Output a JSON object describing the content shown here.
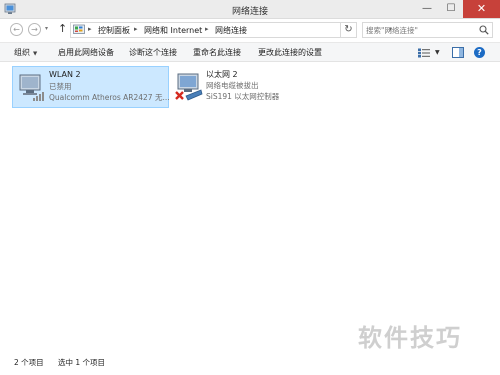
{
  "window": {
    "title": "网络连接",
    "minimize_glyph": "—",
    "maximize_glyph": "☐",
    "close_glyph": "✕"
  },
  "nav": {
    "back_glyph": "←",
    "forward_glyph": "→",
    "history_glyph": "▾",
    "up_glyph": "↑",
    "breadcrumb": [
      "控制面板",
      "网络和 Internet",
      "网络连接"
    ],
    "separator_glyph": "▸",
    "address_dropdown_glyph": "▾",
    "refresh_glyph": "↻",
    "search_placeholder": "搜索\"网络连接\"",
    "search_icon": "search-icon"
  },
  "toolbar": {
    "items": [
      "组织",
      "启用此网络设备",
      "诊断这个连接",
      "重命名此连接",
      "更改此连接的设置"
    ],
    "organize_caret": "▼",
    "view_caret": "▼",
    "help_glyph": "?"
  },
  "connections": [
    {
      "name": "WLAN 2",
      "status": "已禁用",
      "device": "Qualcomm Atheros AR2427 无...",
      "icon": "wireless-adapter-icon",
      "selected": true
    },
    {
      "name": "以太网 2",
      "status": "网络电缆被拔出",
      "device": "SiS191 以太网控制器",
      "icon": "ethernet-adapter-disconnected-icon",
      "selected": false
    }
  ],
  "statusbar": {
    "item_count": "2 个项目",
    "selected_count": "选中 1 个项目"
  },
  "watermark": "软件技巧",
  "colors": {
    "selection_fill": "#cce8ff",
    "selection_border": "#99d1ff",
    "close_button": "#c7413a",
    "help_icon": "#1c6bc4"
  }
}
